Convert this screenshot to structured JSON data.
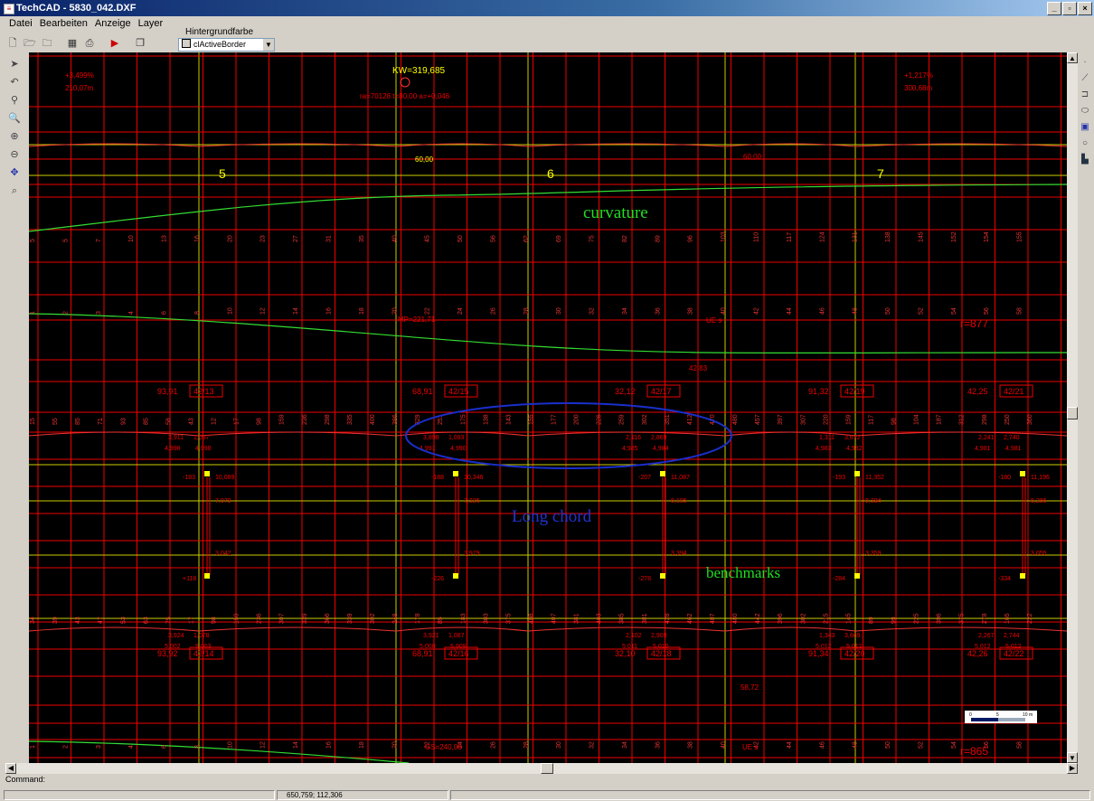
{
  "window": {
    "title": "TechCAD - 5830_042.DXF",
    "min": "_",
    "max": "▫",
    "close": "×"
  },
  "menu": [
    {
      "label": "Datei"
    },
    {
      "label": "Bearbeiten"
    },
    {
      "label": "Anzeige"
    },
    {
      "label": "Layer"
    }
  ],
  "bg_color": {
    "label": "Hintergrundfarbe",
    "value": "clActiveBorder"
  },
  "annotations": {
    "curvature": "curvature",
    "long_chord": "Long chord",
    "benchmarks": "benchmarks"
  },
  "top": {
    "slope_left": "+3,499%",
    "len_left": "210,07m",
    "slope_right": "+1,217%",
    "len_right": "300,68m",
    "kw": "KW=319,685",
    "curve": "ra=70128  t=80,00  a=+0,046",
    "station_60": "60,00",
    "station_60b": "60,00",
    "seg_5": "5",
    "seg_6": "6",
    "seg_7": "7",
    "r1": "r=877",
    "r2": "r=865",
    "ue": "UE s",
    "mp": "MP=221,71",
    "v42": "42,83",
    "v58": "58,72",
    "gs": "GS=240,08"
  },
  "boxes_top": [
    {
      "left": "93,91",
      "box": "42/13"
    },
    {
      "left": "68,91",
      "box": "42/15"
    },
    {
      "left": "32,12",
      "box": "42/17"
    },
    {
      "left": "91,32",
      "box": "42/19"
    },
    {
      "left": "42,25",
      "box": "42/21"
    }
  ],
  "boxes_bottom": [
    {
      "left": "93,92",
      "box": "42/14"
    },
    {
      "left": "68,91",
      "box": "42/16"
    },
    {
      "left": "32,10",
      "box": "42/18"
    },
    {
      "left": "91,34",
      "box": "42/20"
    },
    {
      "left": "42,26",
      "box": "42/22"
    }
  ],
  "chords_top": [
    {
      "a": "3,911",
      "b": "1,087",
      "c": "4,998",
      "d": "4,998"
    },
    {
      "a": "3,898",
      "b": "1,093",
      "c": "4,991",
      "d": "4,990"
    },
    {
      "a": "2,116",
      "b": "2,869",
      "c": "4,985",
      "d": "4,984"
    },
    {
      "a": "1,311",
      "b": "3,672",
      "c": "4,983",
      "d": "4,982"
    },
    {
      "a": "2,241",
      "b": "2,740",
      "c": "4,981",
      "d": "4,981"
    }
  ],
  "chords_bottom": [
    {
      "a": "3,924",
      "b": "1,078",
      "c": "5,002",
      "d": "5,003"
    },
    {
      "a": "3,921",
      "b": "1,087",
      "c": "5,008",
      "d": "5,009"
    },
    {
      "a": "2,102",
      "b": "2,909",
      "c": "5,011",
      "d": "5,010"
    },
    {
      "a": "1,343",
      "b": "3,669",
      "c": "5,012",
      "d": "5,012"
    },
    {
      "a": "2,267",
      "b": "2,744",
      "c": "5,012",
      "d": "5,012"
    }
  ],
  "benchmarks": [
    {
      "top": "-183",
      "v1": "10,089",
      "v2": "7,079",
      "v3": "3,042",
      "bot": "+118"
    },
    {
      "top": "-188",
      "v1": "10,346",
      "v2": "7,326",
      "v3": "2,979",
      "bot": "-226"
    },
    {
      "top": "-207",
      "v1": "11,087",
      "v2": "8,105",
      "v3": "3,394",
      "bot": "-278"
    },
    {
      "top": "-193",
      "v1": "11,352",
      "v2": "8,394",
      "v3": "3,359",
      "bot": "-284"
    },
    {
      "top": "-180",
      "v1": "11,196",
      "v2": "8,286",
      "v3": "3,055",
      "bot": "-334"
    }
  ],
  "ticks_top": [
    "5",
    "5",
    "7",
    "10",
    "13",
    "16",
    "20",
    "23",
    "27",
    "31",
    "35",
    "40",
    "45",
    "50",
    "56",
    "62",
    "69",
    "75",
    "82",
    "89",
    "96",
    "103",
    "110",
    "117",
    "124",
    "131",
    "138",
    "145",
    "152",
    "154",
    "155"
  ],
  "ticks_mid": [
    "1",
    "2",
    "3",
    "4",
    "6",
    "8",
    "10",
    "12",
    "14",
    "16",
    "18",
    "20",
    "22",
    "24",
    "26",
    "28",
    "30",
    "32",
    "34",
    "36",
    "38",
    "40",
    "42",
    "44",
    "46",
    "48",
    "50",
    "52",
    "54",
    "56",
    "58"
  ],
  "ticks_row3": [
    "15",
    "55",
    "85",
    "71",
    "93",
    "85",
    "58",
    "43",
    "12",
    "17",
    "98",
    "159",
    "236",
    "298",
    "335",
    "400",
    "386",
    "329",
    "251",
    "175",
    "138",
    "143",
    "155",
    "177",
    "200",
    "226",
    "259",
    "302",
    "351",
    "412",
    "470",
    "480",
    "457",
    "397",
    "307",
    "220",
    "159",
    "117",
    "98",
    "104",
    "187",
    "312",
    "298",
    "250",
    "360"
  ],
  "ticks_row4": [
    "34",
    "39",
    "43",
    "47",
    "53",
    "63",
    "75",
    "17",
    "98",
    "159",
    "236",
    "307",
    "339",
    "366",
    "339",
    "302",
    "248",
    "178",
    "85",
    "183",
    "303",
    "375",
    "408",
    "407",
    "381",
    "403",
    "385",
    "381",
    "428",
    "462",
    "487",
    "480",
    "442",
    "396",
    "302",
    "215",
    "145",
    "89",
    "99",
    "225",
    "396",
    "375",
    "278",
    "165",
    "222"
  ],
  "scale_bar": {
    "a": "0",
    "b": "5",
    "c": "10 m"
  },
  "status": {
    "command_label": "Command:",
    "coords": "650,759; 112,306"
  }
}
